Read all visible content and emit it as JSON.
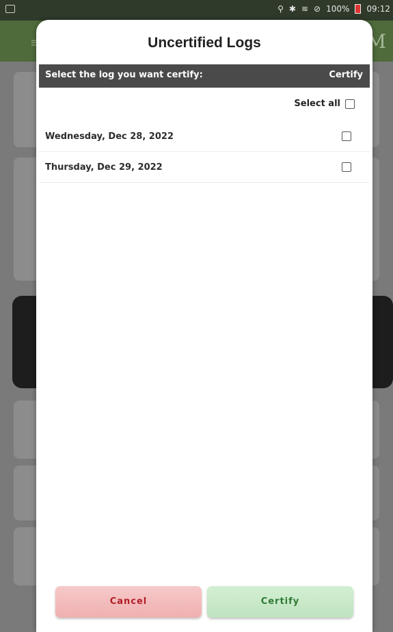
{
  "status_bar": {
    "battery_text": "100%",
    "time": "09:12"
  },
  "app_bar": {
    "brand_letter": "M"
  },
  "dialog": {
    "title": "Uncertified Logs",
    "header": {
      "instruction": "Select the log you want certify:",
      "certify_column": "Certify"
    },
    "select_all_label": "Select all",
    "logs": [
      {
        "date": "Wednesday, Dec 28, 2022",
        "checked": false
      },
      {
        "date": "Thursday, Dec 29, 2022",
        "checked": false
      }
    ],
    "buttons": {
      "cancel": "Cancel",
      "certify": "Certify"
    }
  },
  "colors": {
    "header_bar": "#4a4a4a",
    "cancel_text": "#b11e28",
    "certify_text": "#2f7a35",
    "app_bar": "#4f6b3b"
  }
}
